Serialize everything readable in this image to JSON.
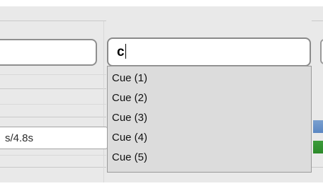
{
  "form": {
    "left_field_value": "",
    "time_value": "s/4.8s"
  },
  "search": {
    "value": "c"
  },
  "autocomplete": {
    "options": [
      "Cue (1)",
      "Cue (2)",
      "Cue (3)",
      "Cue (4)",
      "Cue (5)"
    ]
  },
  "colors": {
    "panel_background": "#e9e9e9",
    "dropdown_background": "#dcdcdc",
    "swatch_blue": "#6a93c9",
    "swatch_green": "#349434"
  }
}
